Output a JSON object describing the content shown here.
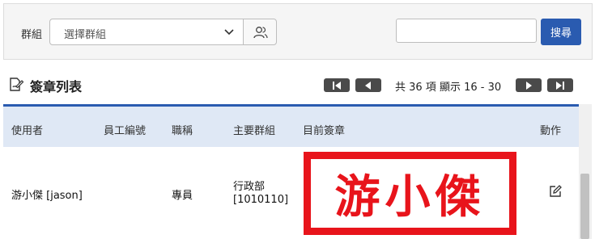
{
  "filter": {
    "group_label": "群組",
    "group_select_value": "選擇群組",
    "search_value": "",
    "search_button": "搜尋"
  },
  "list": {
    "title": "簽章列表"
  },
  "pager": {
    "info": "共 36 項 顯示 16 - 30"
  },
  "table": {
    "columns": [
      "使用者",
      "員工編號",
      "職稱",
      "主要群組",
      "目前簽章",
      "動作"
    ],
    "rows": [
      {
        "user": "游小傑 [jason]",
        "employee_id": "",
        "title": "專員",
        "group_name": "行政部",
        "group_code": "[1010110]",
        "signature_text": "游小傑"
      }
    ]
  },
  "icons": {
    "list": "signature-list-icon",
    "group": "users-icon",
    "edit": "edit-icon",
    "chevron": "chevron-down-icon"
  },
  "colors": {
    "primary": "#2a5bb0",
    "header_bg": "#dfe8f5",
    "signature_red": "#e8141b",
    "pager_dark": "#4a4a4a"
  }
}
